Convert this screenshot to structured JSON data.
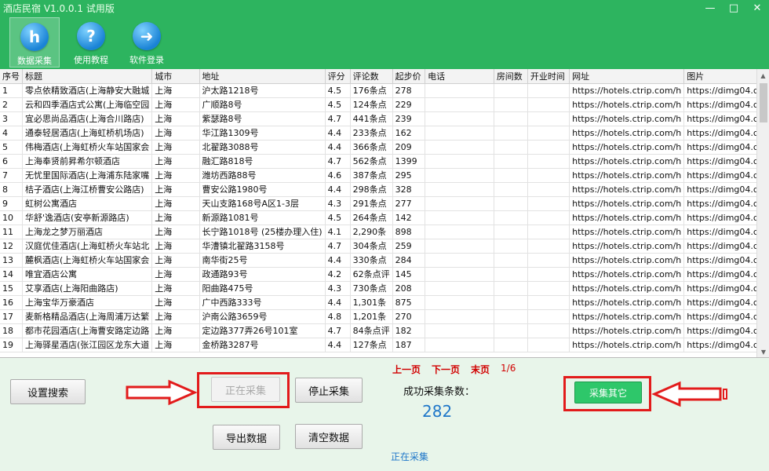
{
  "app": {
    "title": "酒店民宿 V1.0.0.1 试用版"
  },
  "window": {
    "minimize": "—",
    "maximize": "□",
    "close": "✕"
  },
  "toolbar": [
    {
      "label": "数据采集",
      "icon": "h"
    },
    {
      "label": "使用教程",
      "icon": "?"
    },
    {
      "label": "软件登录",
      "icon": "➜"
    }
  ],
  "table": {
    "columns": [
      "序号",
      "标题",
      "城市",
      "地址",
      "评分",
      "评论数",
      "起步价",
      "电话",
      "房间数",
      "开业时间",
      "网址",
      "图片"
    ],
    "rows": [
      [
        "1",
        "零点依精致酒店(上海静安大融城",
        "上海",
        "沪太路1218号",
        "4.5",
        "176条点",
        "278",
        "",
        "",
        "",
        "https://hotels.ctrip.com/h",
        "https://dimg04.c-c"
      ],
      [
        "2",
        "云和四季酒店式公寓(上海临空园",
        "上海",
        "广顺路8号",
        "4.5",
        "124条点",
        "229",
        "",
        "",
        "",
        "https://hotels.ctrip.com/h",
        "https://dimg04.c-c"
      ],
      [
        "3",
        "宜必思尚品酒店(上海合川路店)",
        "上海",
        "紫瑟路8号",
        "4.7",
        "441条点",
        "239",
        "",
        "",
        "",
        "https://hotels.ctrip.com/h",
        "https://dimg04.c-c"
      ],
      [
        "4",
        "通泰轻居酒店(上海虹桥机场店)",
        "上海",
        "华江路1309号",
        "4.4",
        "233条点",
        "162",
        "",
        "",
        "",
        "https://hotels.ctrip.com/h",
        "https://dimg04.c-c"
      ],
      [
        "5",
        "伟梅酒店(上海虹桥火车站国家会",
        "上海",
        "北翟路3088号",
        "4.4",
        "366条点",
        "209",
        "",
        "",
        "",
        "https://hotels.ctrip.com/h",
        "https://dimg04.c-c"
      ],
      [
        "6",
        "上海奉贤前昇希尔顿酒店",
        "上海",
        "融汇路818号",
        "4.7",
        "562条点",
        "1399",
        "",
        "",
        "",
        "https://hotels.ctrip.com/h",
        "https://dimg04.c-c"
      ],
      [
        "7",
        "无忧里国际酒店(上海浦东陆家嘴",
        "上海",
        "潍坊西路88号",
        "4.6",
        "387条点",
        "295",
        "",
        "",
        "",
        "https://hotels.ctrip.com/h",
        "https://dimg04.c-c"
      ],
      [
        "8",
        "桔子酒店(上海江桥曹安公路店)",
        "上海",
        "曹安公路1980号",
        "4.4",
        "298条点",
        "328",
        "",
        "",
        "",
        "https://hotels.ctrip.com/h",
        "https://dimg04.c-c"
      ],
      [
        "9",
        "虹树公寓酒店",
        "上海",
        "天山支路168号A区1-3层",
        "4.3",
        "291条点",
        "277",
        "",
        "",
        "",
        "https://hotels.ctrip.com/h",
        "https://dimg04.c-c"
      ],
      [
        "10",
        "华舒'逸酒店(安亭新源路店)",
        "上海",
        "新源路1081号",
        "4.5",
        "264条点",
        "142",
        "",
        "",
        "",
        "https://hotels.ctrip.com/h",
        "https://dimg04.c-c"
      ],
      [
        "11",
        "上海龙之梦万丽酒店",
        "上海",
        "长宁路1018号 (25楼办理入住)",
        "4.1",
        "2,290条",
        "898",
        "",
        "",
        "",
        "https://hotels.ctrip.com/h",
        "https://dimg04.c-c"
      ],
      [
        "12",
        "汉庭优佳酒店(上海虹桥火车站北",
        "上海",
        "华漕镇北翟路3158号",
        "4.7",
        "304条点",
        "259",
        "",
        "",
        "",
        "https://hotels.ctrip.com/h",
        "https://dimg04.c-c"
      ],
      [
        "13",
        "麓枫酒店(上海虹桥火车站国家会",
        "上海",
        "南华街25号",
        "4.4",
        "330条点",
        "284",
        "",
        "",
        "",
        "https://hotels.ctrip.com/h",
        "https://dimg04.c-c"
      ],
      [
        "14",
        "唯宜酒店公寓",
        "上海",
        "政通路93号",
        "4.2",
        "62条点评",
        "145",
        "",
        "",
        "",
        "https://hotels.ctrip.com/h",
        "https://dimg04.c-c"
      ],
      [
        "15",
        "艾享酒店(上海阳曲路店)",
        "上海",
        "阳曲路475号",
        "4.3",
        "730条点",
        "208",
        "",
        "",
        "",
        "https://hotels.ctrip.com/h",
        "https://dimg04.c-c"
      ],
      [
        "16",
        "上海宝华万豪酒店",
        "上海",
        "广中西路333号",
        "4.4",
        "1,301条",
        "875",
        "",
        "",
        "",
        "https://hotels.ctrip.com/h",
        "https://dimg04.c-c"
      ],
      [
        "17",
        "麦新格精品酒店(上海周浦万达繁",
        "上海",
        "沪南公路3659号",
        "4.8",
        "1,201条",
        "270",
        "",
        "",
        "",
        "https://hotels.ctrip.com/h",
        "https://dimg04.c-c"
      ],
      [
        "18",
        "都市花园酒店(上海曹安路定边路",
        "上海",
        "定边路377弄26号101室",
        "4.7",
        "84条点评",
        "182",
        "",
        "",
        "",
        "https://hotels.ctrip.com/h",
        "https://dimg04.c-c"
      ],
      [
        "19",
        "上海驿星酒店(张江园区龙东大道",
        "上海",
        "金桥路3287号",
        "4.4",
        "127条点",
        "187",
        "",
        "",
        "",
        "https://hotels.ctrip.com/h",
        "https://dimg04.c-c"
      ]
    ]
  },
  "controls": {
    "settings": "设置搜索",
    "collecting": "正在采集",
    "stop": "停止采集",
    "export": "导出数据",
    "clear": "清空数据",
    "collect_other": "采集其它"
  },
  "pager": {
    "prev": "上一页",
    "next": "下一页",
    "last": "末页",
    "page": "1/6"
  },
  "result": {
    "label": "成功采集条数：",
    "count": "282"
  },
  "status": "正在采集"
}
